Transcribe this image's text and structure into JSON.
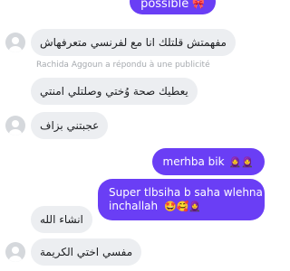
{
  "messages": {
    "out_top": {
      "text": "possible",
      "emoji": "🎀"
    },
    "in1": {
      "text": "مفهمتش قلتلك انا مع لفرنسي متعرفهاش"
    },
    "reply_note": "Rachida Aggoun a répondu à une publicité",
    "in2": {
      "text": "يعطيك صحة وُختي وصلتلي امنتي"
    },
    "in3": {
      "text": "عجبتني بزاف"
    },
    "out1": {
      "text": "merhba bik",
      "emoji": "🧕🧕"
    },
    "out2": {
      "line1": "Super tlbsiha b saha wlehna",
      "line2": "inchallah",
      "emoji": "🤩🥰🧕"
    },
    "in4": {
      "text": "انشاء الله"
    },
    "in5": {
      "text": "مفسي اختي الكريمة"
    }
  },
  "colors": {
    "outgoing_bubble": "#6a3ef5",
    "incoming_bubble": "#eceef1",
    "avatar": "#d5d8dc"
  }
}
